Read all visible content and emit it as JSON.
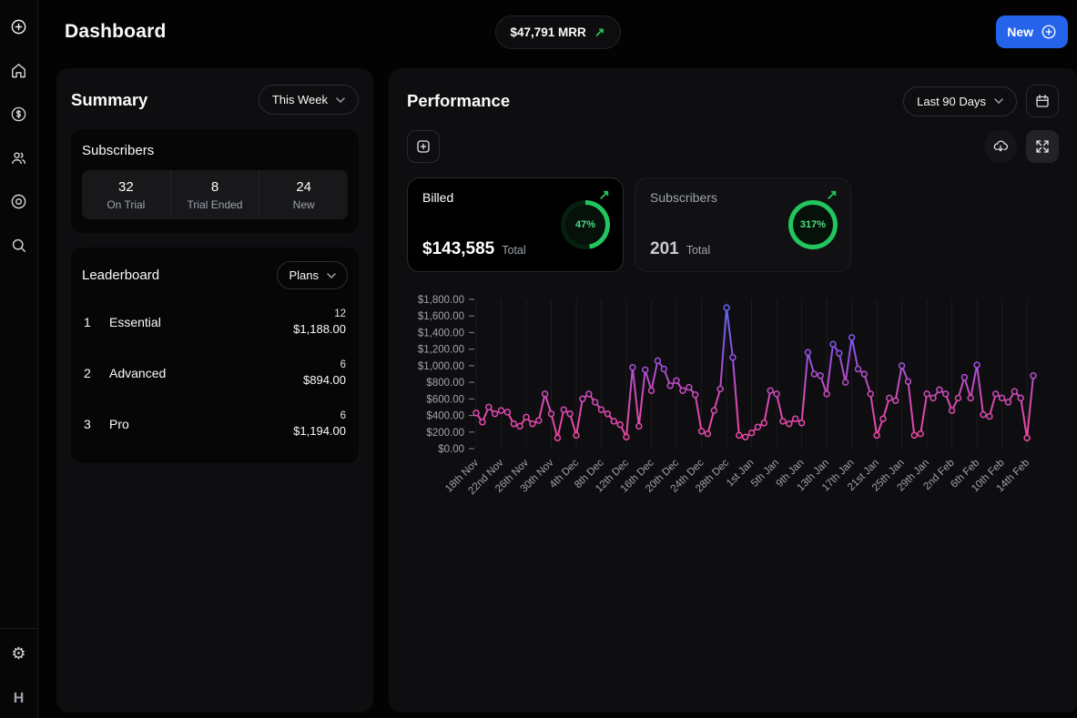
{
  "header": {
    "title": "Dashboard",
    "mrr_badge": "$47,791 MRR",
    "new_button": "New"
  },
  "icons": {
    "trend_up": "↗",
    "settings_gear": "⚙"
  },
  "sidebar": {
    "icons": [
      "add-circle",
      "home",
      "billing",
      "customers",
      "target",
      "search",
      "settings"
    ],
    "avatar_initial": "H"
  },
  "summary": {
    "title": "Summary",
    "period_filter": "This Week",
    "subscribers_card": {
      "title": "Subscribers",
      "stats": [
        {
          "value": "32",
          "label": "On Trial"
        },
        {
          "value": "8",
          "label": "Trial Ended"
        },
        {
          "value": "24",
          "label": "New"
        }
      ]
    },
    "leaderboard_card": {
      "title": "Leaderboard",
      "filter": "Plans",
      "rows": [
        {
          "rank": "1",
          "name": "Essential",
          "count": "12",
          "amount": "$1,188.00"
        },
        {
          "rank": "2",
          "name": "Advanced",
          "count": "6",
          "amount": "$894.00"
        },
        {
          "rank": "3",
          "name": "Pro",
          "count": "6",
          "amount": "$1,194.00"
        }
      ]
    }
  },
  "performance": {
    "title": "Performance",
    "period_filter": "Last 90 Days",
    "cards": [
      {
        "label": "Billed",
        "value": "$143,585",
        "suffix": "Total",
        "percent": "47%",
        "percent_value": 47
      },
      {
        "label": "Subscribers",
        "value": "201",
        "suffix": "Total",
        "percent": "317%",
        "percent_value": 317
      }
    ]
  },
  "colors": {
    "accent_green": "#22c55e",
    "primary_blue": "#2563eb",
    "chart_gradient_high": "#5d6af5",
    "chart_gradient_low": "#f4479b"
  },
  "chart_data": {
    "type": "line",
    "title": "",
    "xlabel": "",
    "ylabel": "",
    "legend": false,
    "grid": "vertical-faint",
    "ylim": [
      0,
      1800
    ],
    "ytick_step": 200,
    "ytick_labels": [
      "$0.00",
      "$200.00",
      "$400.00",
      "$600.00",
      "$800.00",
      "$1,000.00",
      "$1,200.00",
      "$1,400.00",
      "$1,600.00",
      "$1,800.00"
    ],
    "xtick_every": 4,
    "xtick_labels": [
      "18th Nov",
      "22nd Nov",
      "26th Nov",
      "30th Nov",
      "4th Dec",
      "8th Dec",
      "12th Dec",
      "16th Dec",
      "20th Dec",
      "24th Dec",
      "28th Dec",
      "1st Jan",
      "5th Jan",
      "9th Jan",
      "13th Jan",
      "17th Jan",
      "21st Jan",
      "25th Jan",
      "29th Jan",
      "2nd Feb",
      "6th Feb",
      "10th Feb",
      "14th Feb"
    ],
    "gradient": [
      "#5d6af5",
      "#8a52ea",
      "#d44ab4",
      "#f4479b"
    ],
    "x": [
      "18th Nov",
      "19th Nov",
      "20th Nov",
      "21st Nov",
      "22nd Nov",
      "23rd Nov",
      "24th Nov",
      "25th Nov",
      "26th Nov",
      "27th Nov",
      "28th Nov",
      "29th Nov",
      "30th Nov",
      "1st Dec",
      "2nd Dec",
      "3rd Dec",
      "4th Dec",
      "5th Dec",
      "6th Dec",
      "7th Dec",
      "8th Dec",
      "9th Dec",
      "10th Dec",
      "11th Dec",
      "12th Dec",
      "13th Dec",
      "14th Dec",
      "15th Dec",
      "16th Dec",
      "17th Dec",
      "18th Dec",
      "19th Dec",
      "20th Dec",
      "21st Dec",
      "22nd Dec",
      "23rd Dec",
      "24th Dec",
      "25th Dec",
      "26th Dec",
      "27th Dec",
      "28th Dec",
      "29th Dec",
      "30th Dec",
      "31st Dec",
      "1st Jan",
      "2nd Jan",
      "3rd Jan",
      "4th Jan",
      "5th Jan",
      "6th Jan",
      "7th Jan",
      "8th Jan",
      "9th Jan",
      "10th Jan",
      "11th Jan",
      "12th Jan",
      "13th Jan",
      "14th Jan",
      "15th Jan",
      "16th Jan",
      "17th Jan",
      "18th Jan",
      "19th Jan",
      "20th Jan",
      "21st Jan",
      "22nd Jan",
      "23rd Jan",
      "24th Jan",
      "25th Jan",
      "26th Jan",
      "27th Jan",
      "28th Jan",
      "29th Jan",
      "30th Jan",
      "31st Jan",
      "1st Feb",
      "2nd Feb",
      "3rd Feb",
      "4th Feb",
      "5th Feb",
      "6th Feb",
      "7th Feb",
      "8th Feb",
      "9th Feb",
      "10th Feb",
      "11th Feb",
      "12th Feb",
      "13th Feb",
      "14th Feb",
      "15th Feb"
    ],
    "values": [
      430,
      320,
      500,
      420,
      460,
      440,
      300,
      270,
      380,
      300,
      340,
      660,
      420,
      130,
      470,
      420,
      160,
      600,
      660,
      560,
      470,
      420,
      330,
      290,
      140,
      980,
      270,
      950,
      700,
      1060,
      960,
      760,
      820,
      700,
      740,
      650,
      210,
      180,
      460,
      720,
      1700,
      1100,
      160,
      140,
      190,
      260,
      310,
      700,
      660,
      330,
      300,
      360,
      310,
      1160,
      900,
      880,
      660,
      1260,
      1150,
      800,
      1340,
      960,
      900,
      660,
      160,
      360,
      610,
      580,
      1000,
      810,
      160,
      180,
      660,
      610,
      710,
      660,
      460,
      610,
      860,
      610,
      1010,
      410,
      390,
      660,
      610,
      560,
      690,
      610,
      130,
      880
    ]
  }
}
